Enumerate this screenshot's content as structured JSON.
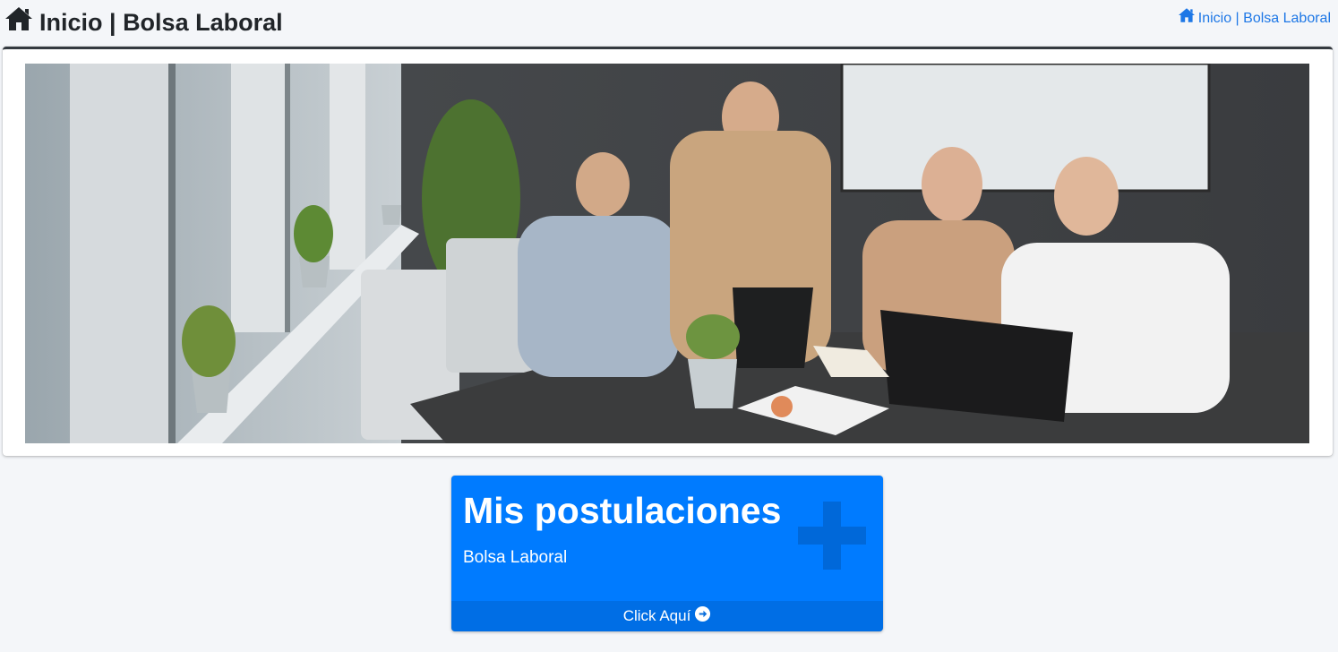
{
  "header": {
    "title": "Inicio | Bolsa Laboral",
    "title_icon": "home-icon"
  },
  "breadcrumb": {
    "label": "Inicio | Bolsa Laboral",
    "icon": "home-icon",
    "color": "#1d77e6"
  },
  "hero": {
    "description": "office team photo"
  },
  "small_box": {
    "title": "Mis postulaciones",
    "subtitle": "Bolsa Laboral",
    "footer_label": "Click Aquí",
    "footer_icon": "arrow-circle-right-icon",
    "decor_icon": "plus-icon",
    "color": "#007bff"
  }
}
